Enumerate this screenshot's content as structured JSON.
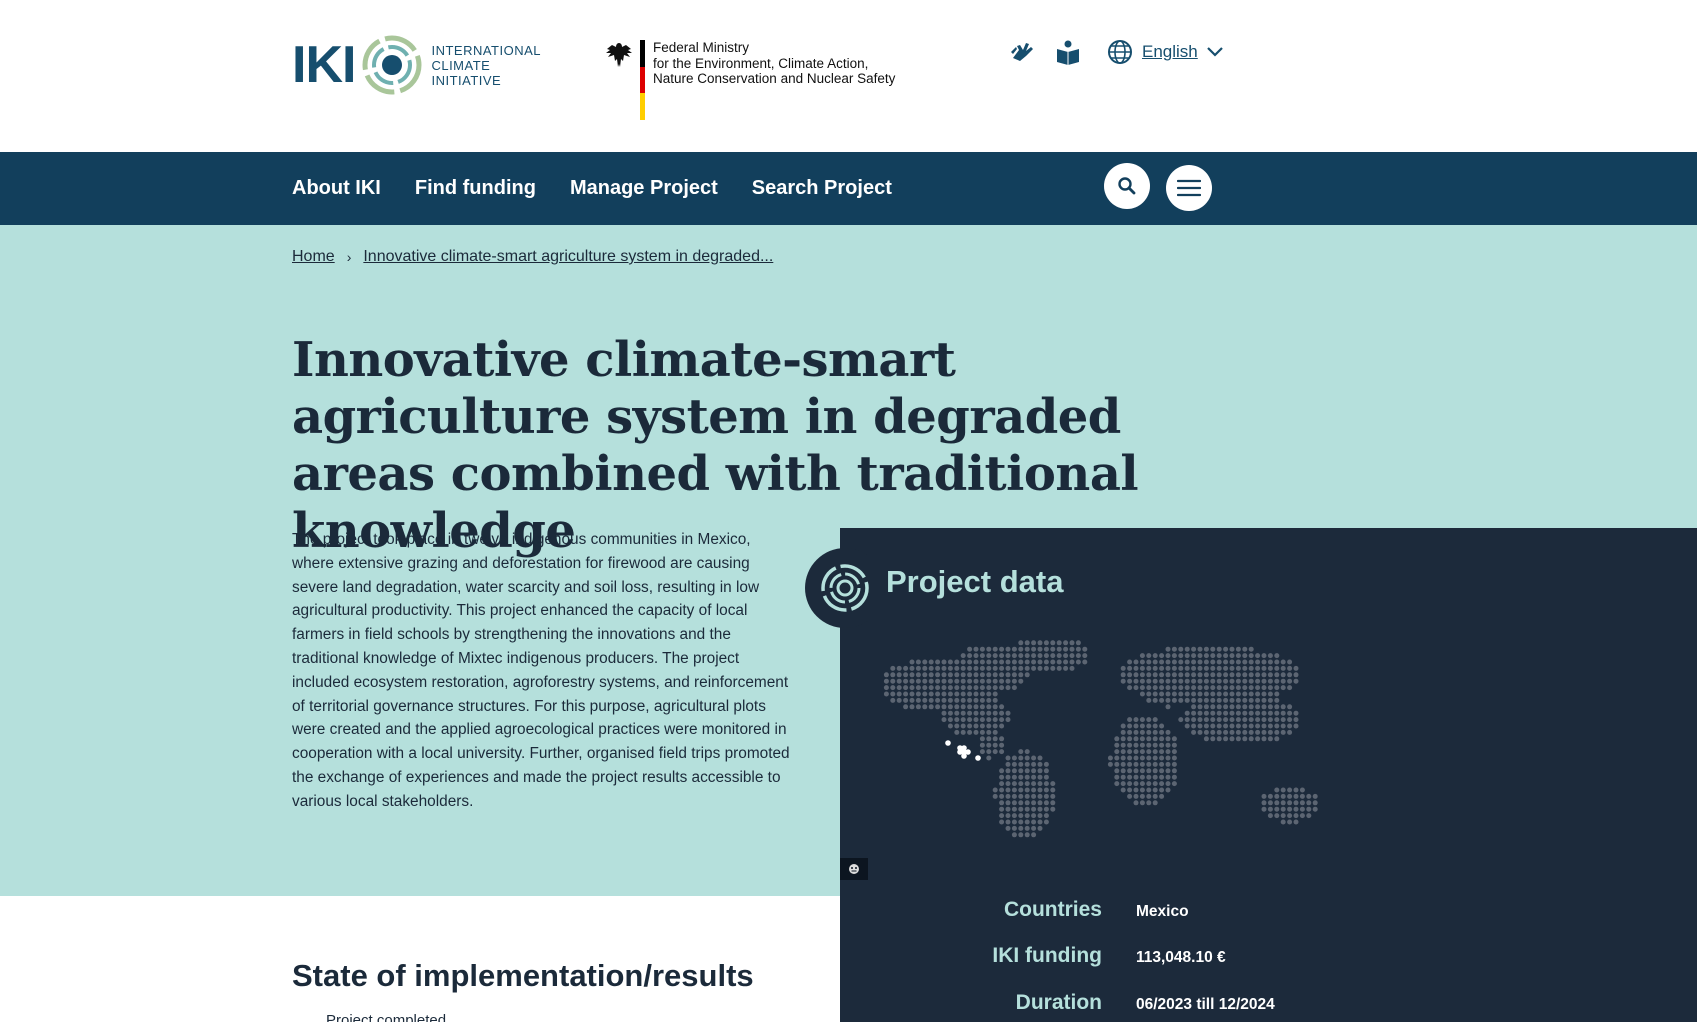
{
  "header": {
    "iki_logo_text": "IKI",
    "iki_subtitle": [
      "INTERNATIONAL",
      "CLIMATE",
      "INITIATIVE"
    ],
    "ministry_lines": [
      "Federal Ministry",
      "for the Environment, Climate Action,",
      "Nature Conservation and Nuclear Safety"
    ],
    "language": "English"
  },
  "nav": {
    "items": [
      "About IKI",
      "Find funding",
      "Manage Project",
      "Search Project"
    ]
  },
  "breadcrumb": {
    "home": "Home",
    "current": "Innovative climate-smart agriculture system in degraded..."
  },
  "page": {
    "title": "Innovative climate-smart agriculture system in degraded areas combined with traditional knowledge",
    "description": "The project took place in twelve indigenous communities in Mexico, where extensive grazing and deforestation for firewood are causing severe land degradation, water scarcity and soil loss, resulting in low agricultural productivity. This project enhanced the capacity of local farmers in field schools by strengthening the innovations and the traditional knowledge of Mixtec indigenous producers. The project included ecosystem restoration, agroforestry systems, and reinforcement of territorial governance structures. For this purpose, agricultural plots were created and the applied agroecological practices were monitored in cooperation with a local university. Further, organised field trips promoted the exchange of experiences and made the project results accessible to various local stakeholders."
  },
  "project_data": {
    "heading": "Project data",
    "rows": [
      {
        "label": "Countries",
        "value": "Mexico"
      },
      {
        "label": "IKI funding",
        "value": "113,048.10 €"
      },
      {
        "label": "Duration",
        "value": "06/2023 till 12/2024"
      }
    ]
  },
  "results": {
    "heading": "State of implementation/results",
    "status": "Project completed"
  },
  "colors": {
    "nav_bg": "#123f5c",
    "hero_bg": "#b5e0dc",
    "panel_bg": "#1c2a3b",
    "accent": "#b5e0dc"
  }
}
